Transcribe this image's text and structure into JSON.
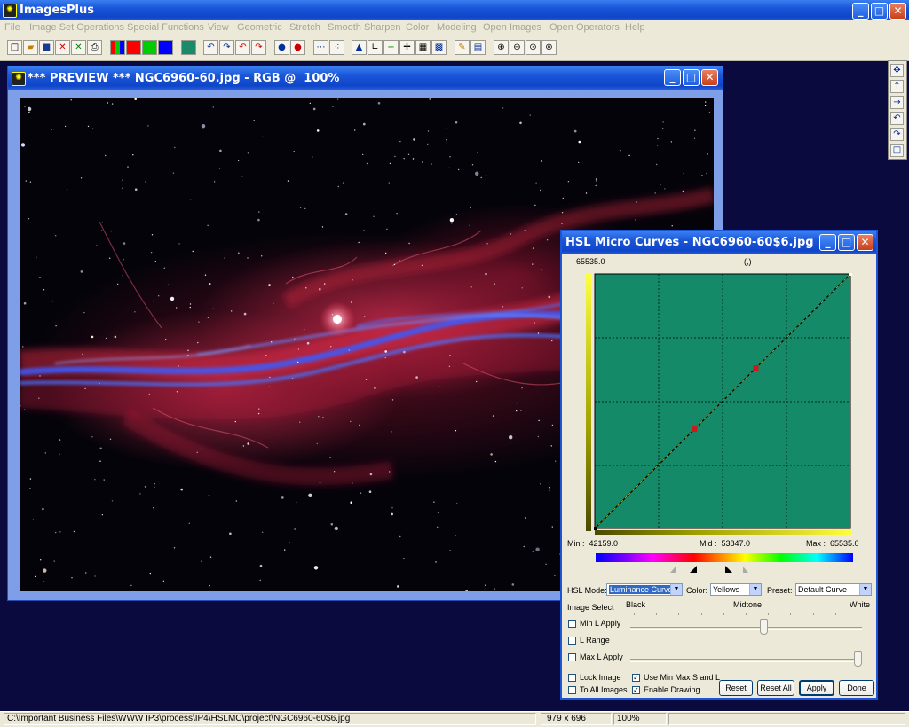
{
  "app": {
    "title": "ImagesPlus"
  },
  "menu": [
    "File",
    "Image Set Operations",
    "Special Functions",
    "View",
    "Geometric",
    "Stretch",
    "Smooth Sharpen",
    "Color",
    "Modeling",
    "Open Images",
    "Open Operators",
    "Help"
  ],
  "preview": {
    "title": "*** PREVIEW *** NGC6960-60.jpg - RGB @  100%"
  },
  "hsl": {
    "title": "HSL Micro Curves - NGC6960-60$6.jpg",
    "top_value": "65535.0",
    "cursor_readout": "(,)",
    "min_text": "Min :  42159.0",
    "mid_text": "Mid :  53847.0",
    "max_text": "Max :  65535.0",
    "mode_label": "HSL Mode:",
    "mode_value": "Luminance Curve",
    "color_label": "Color:",
    "color_value": "Yellows",
    "preset_label": "Preset:",
    "preset_value": "Default Curve",
    "image_select": "Image Select",
    "black": "Black",
    "midtone": "Midtone",
    "white": "White",
    "min_l_apply": "Min L Apply",
    "l_range": "L Range",
    "max_l_apply": "Max L Apply",
    "lock_image": "Lock Image",
    "to_all_images": "To All Images",
    "use_min_max": "Use Min Max S and L",
    "enable_drawing": "Enable Drawing",
    "reset": "Reset",
    "reset_all": "Reset All",
    "apply": "Apply",
    "done": "Done",
    "min_l_apply_checked": false,
    "l_range_checked": false,
    "max_l_apply_checked": false,
    "lock_image_checked": false,
    "to_all_images_checked": false,
    "use_min_max_checked": true,
    "enable_drawing_checked": true,
    "curve_points": [
      [
        0,
        0
      ],
      [
        0.39,
        0.39
      ],
      [
        0.63,
        0.63
      ],
      [
        1,
        1
      ]
    ],
    "min_l_slider": 0.58,
    "max_l_slider": 1.0
  },
  "status": {
    "path": "C:\\Important Business Files\\WWW IP3\\process\\IP4\\HSLMC\\project\\NGC6960-60$6.jpg",
    "size": "979 x 696",
    "zoom": "100%"
  },
  "colors": {
    "curve_bg": "#148a68",
    "title_blue": "#1a55d8",
    "desktop": "#0a0a3e"
  }
}
